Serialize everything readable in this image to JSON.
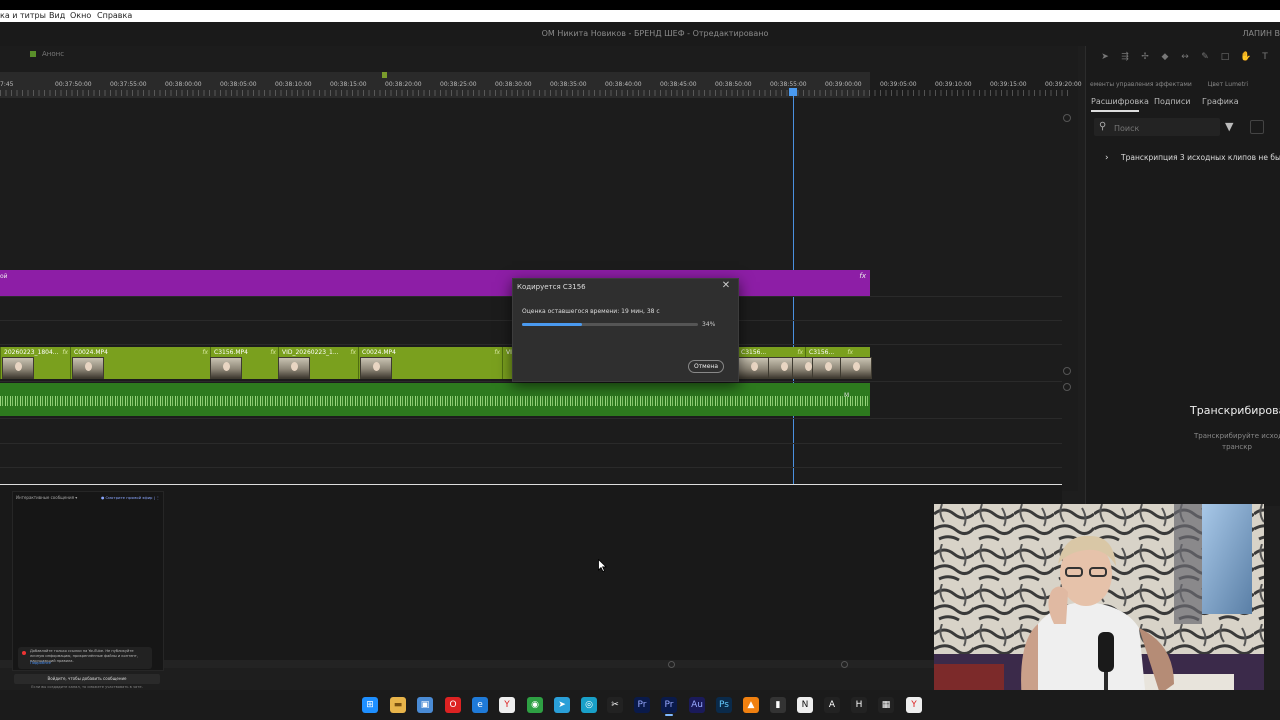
{
  "menu": [
    "ка и титры",
    "Вид",
    "Окно",
    "Справка"
  ],
  "window": {
    "title": "ОМ Никита Новиков - БРЕНД ШЕФ - Отредактировано",
    "user": "ЛАПИН В"
  },
  "sequence": {
    "tab_label": "Анонс"
  },
  "timeline": {
    "ticks": [
      "7:45",
      "00:37:50:00",
      "00:37:55:00",
      "00:38:00:00",
      "00:38:05:00",
      "00:38:10:00",
      "00:38:15:00",
      "00:38:20:00",
      "00:38:25:00",
      "00:38:30:00",
      "00:38:35:00",
      "00:38:40:00",
      "00:38:45:00",
      "00:38:50:00",
      "00:38:55:00",
      "00:39:00:00",
      "00:39:05:00",
      "00:39:10:00",
      "00:39:15:00",
      "00:39:20:00"
    ],
    "purple_clip": {
      "label": "ой",
      "fx": "fx"
    },
    "video_clips": [
      {
        "name": "20260223_1804...",
        "fx": "fx"
      },
      {
        "name": "C0024.MP4",
        "fx": "fx"
      },
      {
        "name": "C3156.MP4",
        "fx": "fx"
      },
      {
        "name": "VID_20260223_1...",
        "fx": "fx"
      },
      {
        "name": "C0024.MP4",
        "fx": "fx"
      },
      {
        "name": "VI",
        "fx": ""
      },
      {
        "name": "C3156...",
        "fx": "fx"
      },
      {
        "name": "C3156...",
        "fx": "fx"
      }
    ],
    "audio_marker": "M"
  },
  "right_panel": {
    "panel_tabs": [
      "ементы управления эффектами",
      "Цвет Lumetri"
    ],
    "transcript_tabs": [
      "Расшифровка",
      "Подписи",
      "Графика"
    ],
    "search_placeholder": "Поиск",
    "transcript_item": "Транскрипция 3 исходных клипов не была в",
    "transcribe_title": "Транскрибирова",
    "transcribe_desc_1": "Транскрибируйте исход",
    "transcribe_desc_2": "транскр"
  },
  "dialog": {
    "title": "Кодируется C3156",
    "remaining": "Оценка оставшегося времени: 19 мин, 38 с",
    "percent_label": "34%",
    "progress": 0.34,
    "cancel_label": "Отмена"
  },
  "chat": {
    "header": "Интерактивные сообщения ▾",
    "live_label": "● Смотрите прямой эфир | ⋮",
    "warning": "Добавляйте только ссылки на YouTube. Не публикуйте личную информацию, прикреплённые файлы и контент, нарушающий правила.",
    "warning_more": "Подробнее",
    "input_label": "Войдите, чтобы добавить сообщение",
    "footer": "Если вы создадите канал, то сможете участвовать в чате."
  },
  "taskbar_icons": [
    "windows-icon",
    "folder-icon",
    "photos-icon",
    "opera-icon",
    "edge-icon",
    "yandex-icon",
    "chrome-icon",
    "telegram-icon",
    "vpn-icon",
    "capcut-icon",
    "premiere-icon",
    "premiere-active-icon",
    "audition-icon",
    "photoshop-icon",
    "vlc-icon",
    "terminal-icon",
    "notion-icon",
    "apps-icon",
    "hh-icon",
    "box-icon",
    "yandex-browser-icon"
  ],
  "colors": {
    "accent": "#4a9af0",
    "purple_clip": "#8d1ea6",
    "video_clip": "#7aa01e",
    "audio_clip": "#2d7a1e"
  }
}
